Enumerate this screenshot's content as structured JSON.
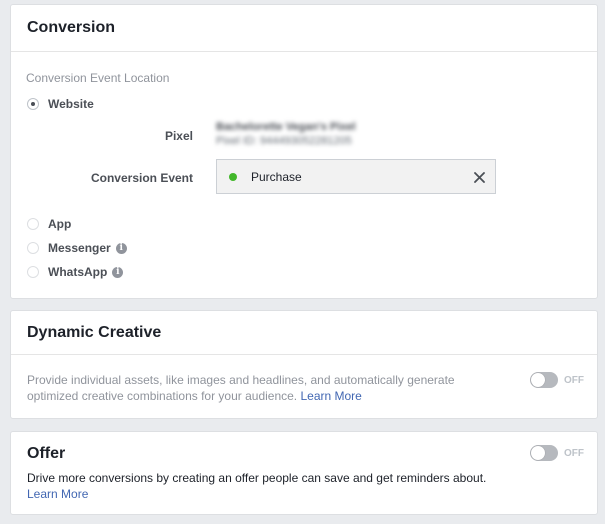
{
  "conversion": {
    "title": "Conversion",
    "location_label": "Conversion Event Location",
    "options": [
      {
        "label": "Website",
        "selected": true,
        "info": false
      },
      {
        "label": "App",
        "selected": false,
        "info": false
      },
      {
        "label": "Messenger",
        "selected": false,
        "info": true
      },
      {
        "label": "WhatsApp",
        "selected": false,
        "info": true
      }
    ],
    "pixel_label": "Pixel",
    "pixel_name": "Bachelorette Vegan's Pixel",
    "pixel_id": "Pixel ID: 944493052281205",
    "event_label": "Conversion Event",
    "event_value": "Purchase",
    "event_status_color": "#42b72a"
  },
  "dynamic_creative": {
    "title": "Dynamic Creative",
    "description": "Provide individual assets, like images and headlines, and automatically generate optimized creative combinations for your audience.",
    "learn_more": "Learn More",
    "toggle_state": "OFF"
  },
  "offer": {
    "title": "Offer",
    "description": "Drive more conversions by creating an offer people can save and get reminders about.",
    "learn_more": "Learn More",
    "toggle_state": "OFF"
  },
  "colors": {
    "accent_link": "#4267b2",
    "background": "#e9ebee"
  }
}
